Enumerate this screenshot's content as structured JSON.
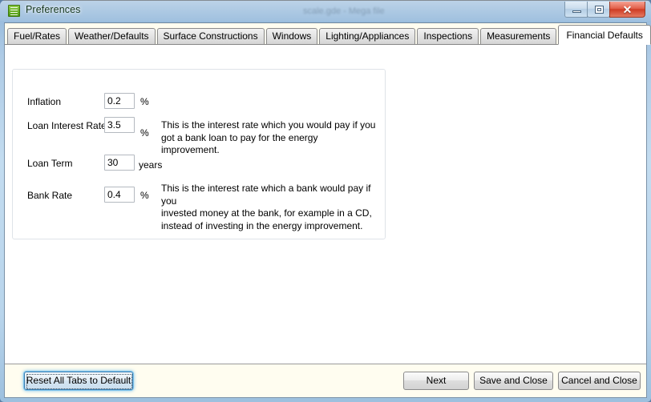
{
  "window": {
    "title": "Preferences",
    "icon": "list-document-icon",
    "ghost_text": "scale.gde - Mega file",
    "controls": {
      "minimize": "–",
      "maximize": "□",
      "close": "✕"
    }
  },
  "tabs": [
    {
      "label": "Fuel/Rates",
      "active": false
    },
    {
      "label": "Weather/Defaults",
      "active": false
    },
    {
      "label": "Surface Constructions",
      "active": false
    },
    {
      "label": "Windows",
      "active": false
    },
    {
      "label": "Lighting/Appliances",
      "active": false
    },
    {
      "label": "Inspections",
      "active": false
    },
    {
      "label": "Measurements",
      "active": false
    },
    {
      "label": "Financial Defaults",
      "active": true
    }
  ],
  "form": {
    "fields": [
      {
        "label": "Inflation",
        "value": "0.2",
        "unit": "%",
        "description": ""
      },
      {
        "label": "Loan Interest Rate",
        "value": "3.5",
        "unit": "%",
        "description": "This is the interest rate which you would pay if you\ngot a bank loan to pay for the energy improvement."
      },
      {
        "label": "Loan Term",
        "value": "30",
        "unit": "years",
        "description": ""
      },
      {
        "label": "Bank Rate",
        "value": "0.4",
        "unit": "%",
        "description": "This is the interest rate which a bank would pay if you\ninvested money at the bank, for example in a CD,\ninstead of investing in the energy improvement."
      }
    ]
  },
  "footer": {
    "reset_label": "Reset All Tabs to Default",
    "next_label": "Next",
    "save_label": "Save and Close",
    "cancel_label": "Cancel and Close"
  },
  "colors": {
    "accent_focus": "#3c7fb1",
    "titlebar_glass": "#bcd8ee",
    "footer_bg": "#fffdf0",
    "close_button": "#cf3c24"
  }
}
